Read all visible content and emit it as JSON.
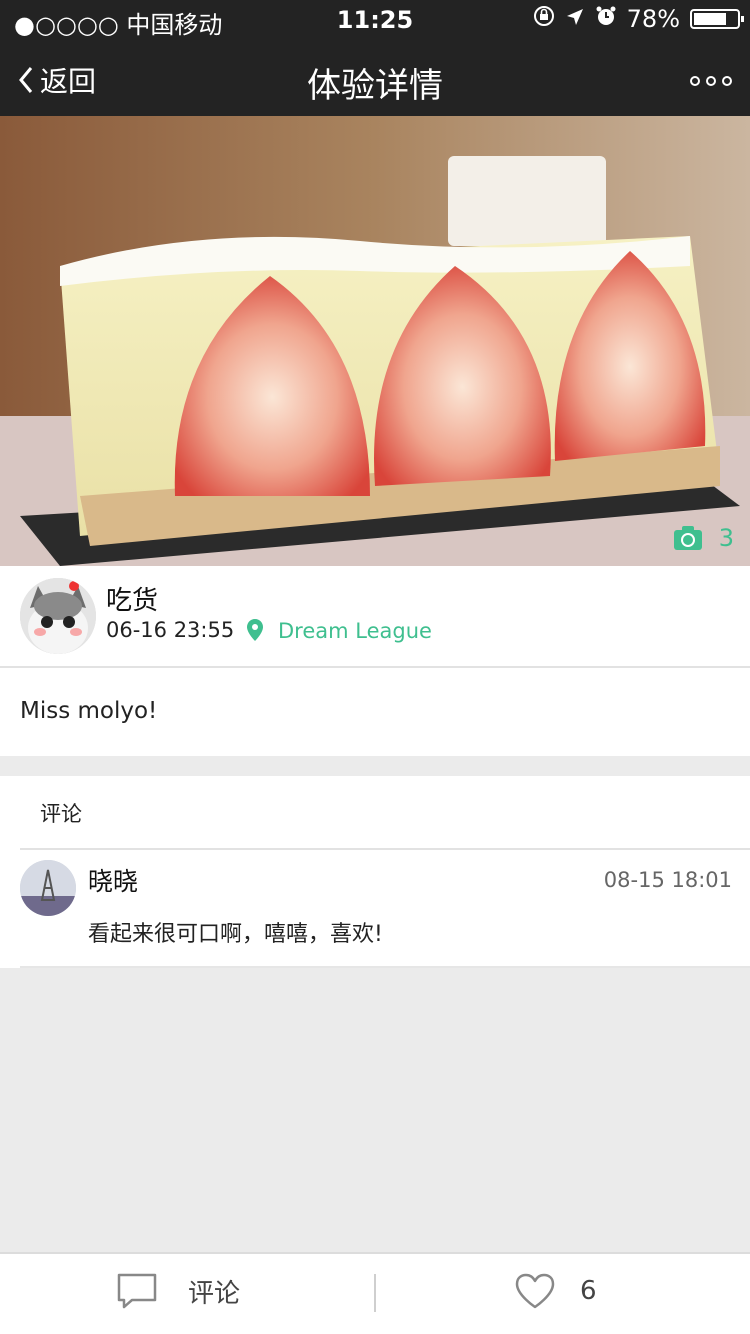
{
  "status_bar": {
    "carrier": "●○○○○ 中国移动",
    "time": "11:25",
    "battery_percent": "78%",
    "battery_level": 0.78
  },
  "nav": {
    "back_label": "返回",
    "title": "体验详情"
  },
  "hero": {
    "photo_count": "3"
  },
  "post": {
    "author_name": "吃货",
    "time": "06-16 23:55",
    "location": "Dream League",
    "text": "Miss molyo!"
  },
  "comments": {
    "header": "评论",
    "items": [
      {
        "name": "晓晓",
        "time": "08-15 18:01",
        "text": "看起来很可口啊，嘻嘻，喜欢!"
      }
    ]
  },
  "bottom_bar": {
    "comment_label": "评论",
    "like_count": "6"
  },
  "colors": {
    "accent": "#3fbf8f",
    "bar_dark": "#232323",
    "page_bg": "#ebebeb"
  }
}
